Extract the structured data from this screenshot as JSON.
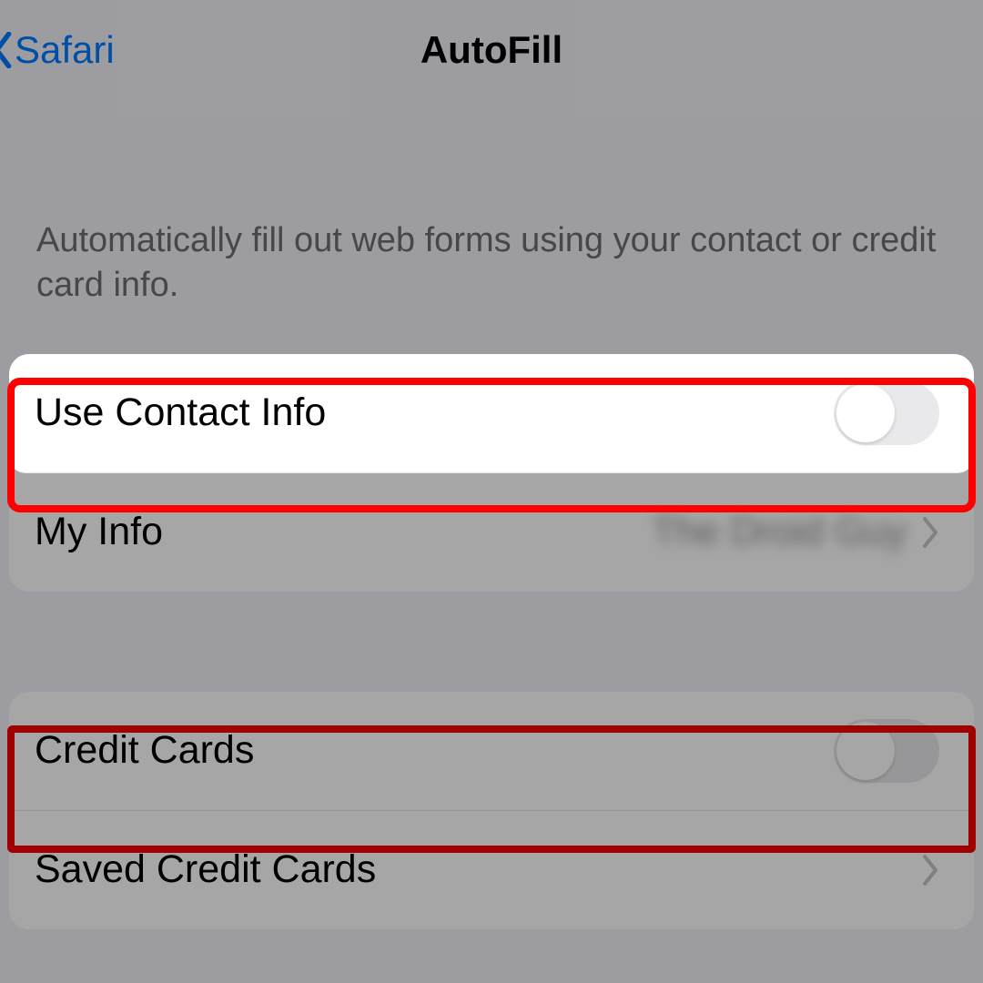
{
  "header": {
    "back_label": "Safari",
    "title": "AutoFill"
  },
  "description": "Automatically fill out web forms using your contact or credit card info.",
  "section1": {
    "use_contact_info_label": "Use Contact Info",
    "my_info_label": "My Info",
    "my_info_value": "The Droid Guy"
  },
  "section2": {
    "credit_cards_label": "Credit Cards",
    "saved_credit_cards_label": "Saved Credit Cards"
  }
}
